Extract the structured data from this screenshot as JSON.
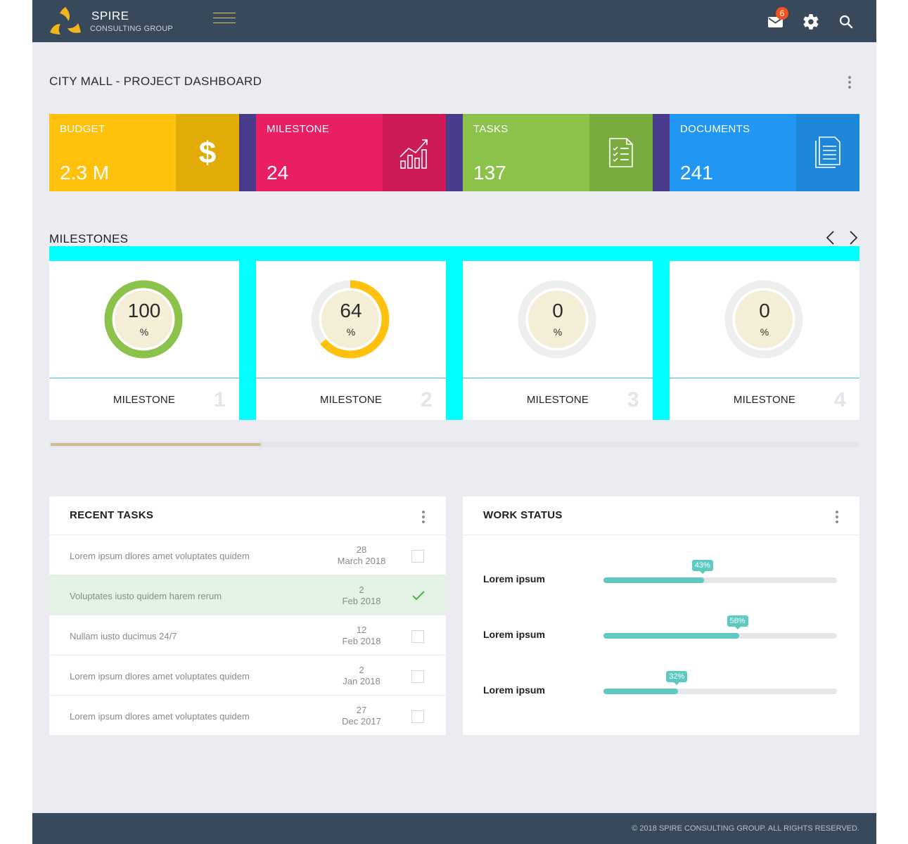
{
  "brand": {
    "name": "SPIRE",
    "subtitle": "CONSULTING GROUP",
    "accent": "#F2B51C"
  },
  "header": {
    "mail_count": "6",
    "icons": [
      "mail-icon",
      "gear-icon",
      "search-icon"
    ]
  },
  "page": {
    "title": "CITY MALL - PROJECT DASHBOARD"
  },
  "stats": [
    {
      "label": "BUDGET",
      "value": "2.3 M",
      "icon": "dollar-icon",
      "color": "#FFC10B",
      "dark": "#E1AC05"
    },
    {
      "label": "MILESTONE",
      "value": "24",
      "icon": "chart-growth-icon",
      "color": "#E91E63",
      "dark": "#CE1A56"
    },
    {
      "label": "TASKS",
      "value": "137",
      "icon": "checklist-icon",
      "color": "#8BC34A",
      "dark": "#79AB3F"
    },
    {
      "label": "DOCUMENTS",
      "value": "241",
      "icon": "documents-icon",
      "color": "#2196F3",
      "dark": "#1D87DA"
    }
  ],
  "milestones": {
    "title": "MILESTONES",
    "items": [
      {
        "value": "100",
        "unit": "%",
        "label": "MILESTONE",
        "number": "1",
        "progress": 100,
        "color": "#8BC34A"
      },
      {
        "value": "64",
        "unit": "%",
        "label": "MILESTONE",
        "number": "2",
        "progress": 64,
        "color": "#FFC10B"
      },
      {
        "value": "0",
        "unit": "%",
        "label": "MILESTONE",
        "number": "3",
        "progress": 0,
        "color": "#EEEEEE"
      },
      {
        "value": "0",
        "unit": "%",
        "label": "MILESTONE",
        "number": "4",
        "progress": 0,
        "color": "#EEEEEE"
      }
    ]
  },
  "recent_tasks": {
    "title": "RECENT TASKS",
    "rows": [
      {
        "text": "Lorem ipsum dlores amet voluptates quidem",
        "day": "28",
        "month": "March 2018",
        "done": false
      },
      {
        "text": "Voluptates iusto quidem harem rerum",
        "day": "2",
        "month": "Feb 2018",
        "done": true
      },
      {
        "text": "Nullam iusto ducimus 24/7",
        "day": "12",
        "month": "Feb 2018",
        "done": false
      },
      {
        "text": "Lorem ipsum dlores amet voluptates quidem",
        "day": "2",
        "month": "Jan 2018",
        "done": false
      },
      {
        "text": "Lorem ipsum dlores amet voluptates quidem",
        "day": "27",
        "month": "Dec 2017",
        "done": false
      }
    ]
  },
  "work_status": {
    "title": "WORK STATUS",
    "items": [
      {
        "label": "Lorem ipsum",
        "percent_text": "43%",
        "percent": 43
      },
      {
        "label": "Lorem ipsum",
        "percent_text": "58%",
        "percent": 58
      },
      {
        "label": "Lorem ipsum",
        "percent_text": "32%",
        "percent": 32
      }
    ]
  },
  "footer": {
    "text": "© 2018 SPIRE CONSULTING GROUP. ALL RIGHTS RESERVED."
  }
}
